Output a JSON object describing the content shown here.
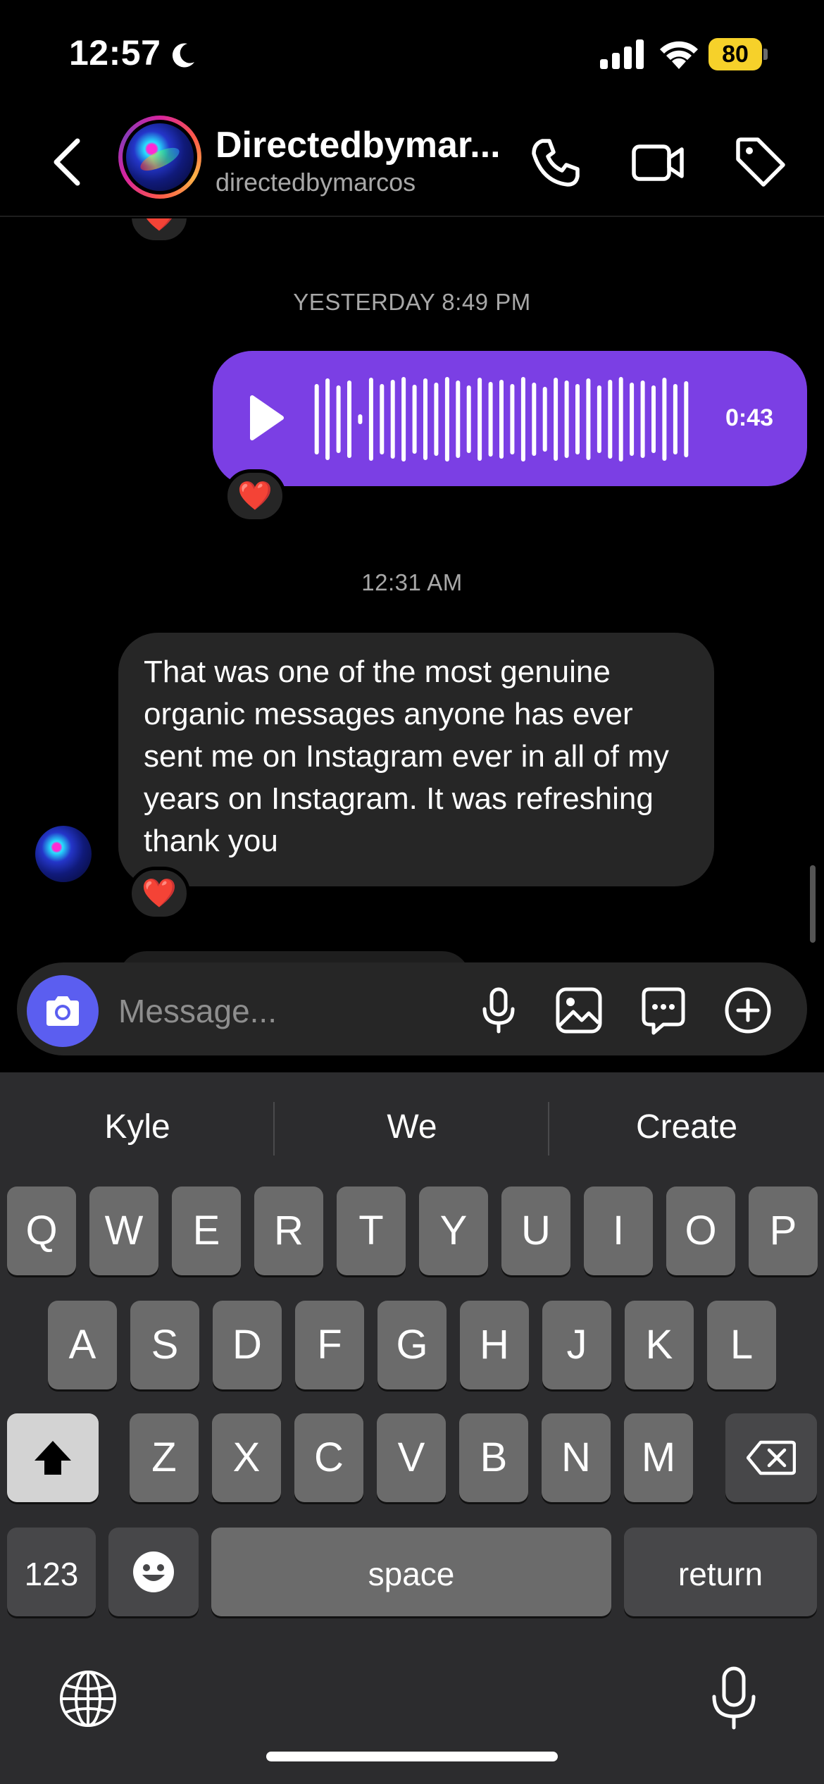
{
  "status_bar": {
    "time": "12:57",
    "battery": "80",
    "icons": [
      "moon-icon",
      "cellular-signal-icon",
      "wifi-icon",
      "battery-icon"
    ]
  },
  "header": {
    "contact_name": "Directedbymar...",
    "username": "directedbymarcos",
    "icons": [
      "back-chevron-icon",
      "phone-icon",
      "video-camera-icon",
      "tag-icon"
    ]
  },
  "chat": {
    "timestamp_1": "YESTERDAY 8:49 PM",
    "voice_message": {
      "duration": "0:43"
    },
    "timestamp_2": "12:31 AM",
    "received_message": "That was one of the most genuine organic messages anyone has ever sent me on Instagram ever in all of my years on Instagram. It was refreshing thank you",
    "reaction": "❤️"
  },
  "composer": {
    "placeholder": "Message...",
    "icons": [
      "camera-icon",
      "microphone-icon",
      "photo-icon",
      "sticker-icon",
      "plus-circle-icon"
    ]
  },
  "keyboard": {
    "suggestions": [
      "Kyle",
      "We",
      "Create"
    ],
    "row1": [
      "Q",
      "W",
      "E",
      "R",
      "T",
      "Y",
      "U",
      "I",
      "O",
      "P"
    ],
    "row2": [
      "A",
      "S",
      "D",
      "F",
      "G",
      "H",
      "J",
      "K",
      "L"
    ],
    "row3": [
      "Z",
      "X",
      "C",
      "V",
      "B",
      "N",
      "M"
    ],
    "numbers_key": "123",
    "space_key": "space",
    "return_key": "return"
  },
  "colors": {
    "accent_purple": "#7b3fe4",
    "camera_button": "#5b5ef0",
    "bubble_gray": "#262626",
    "battery_yellow": "#f6d12a"
  }
}
